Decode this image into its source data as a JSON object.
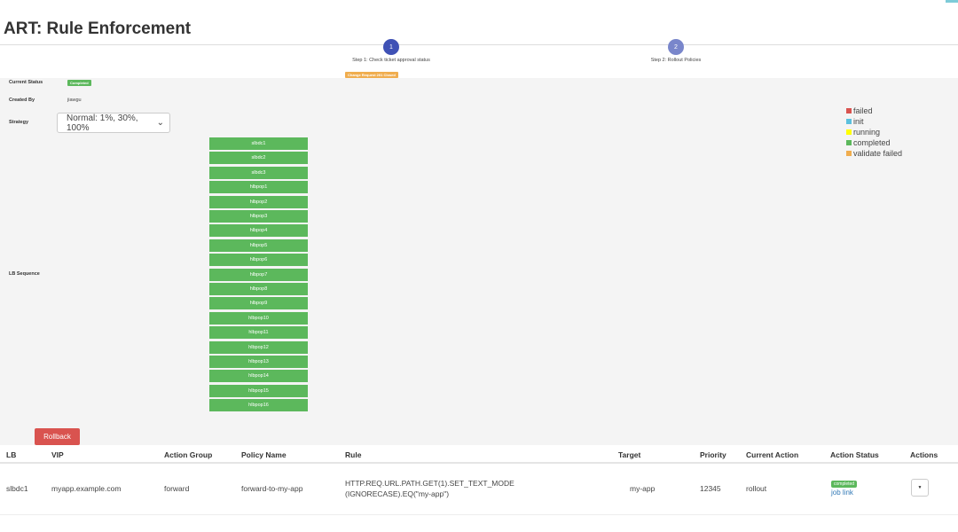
{
  "title": "ART: Rule Enforcement",
  "steps": [
    {
      "number": "1",
      "label": "Step 1: Check ticket approval status",
      "color": "#3f51b5"
    },
    {
      "number": "2",
      "label": "Step 2: Rollout Policies",
      "color": "#7986cb"
    }
  ],
  "step1_badge": "Change Request 201 Closed",
  "info": {
    "current_status_label": "Current Status",
    "current_status": "Completed",
    "created_by_label": "Created By",
    "created_by": "jiawgu",
    "strategy_label": "Strategy",
    "strategy": "Normal: 1%, 30%, 100%",
    "lb_sequence_label": "LB Sequence"
  },
  "lb_sequence": [
    "slbdc1",
    "slbdc2",
    "slbdc3",
    "hlbpop1",
    "hlbpop2",
    "hlbpop3",
    "hlbpop4",
    "hlbpop5",
    "hlbpop6",
    "hlbpop7",
    "hlbpop8",
    "hlbpop9",
    "hlbpop10",
    "hlbpop11",
    "hlbpop12",
    "hlbpop13",
    "hlbpop14",
    "hlbpop15",
    "hlbpop16"
  ],
  "legend": [
    {
      "label": "failed",
      "color": "#d9534f"
    },
    {
      "label": "init",
      "color": "#5bc0de"
    },
    {
      "label": "running",
      "color": "#ffff00"
    },
    {
      "label": "completed",
      "color": "#5cb85c"
    },
    {
      "label": "validate failed",
      "color": "#f0ad4e"
    }
  ],
  "rollback_label": "Rollback",
  "table": {
    "headers": [
      "LB",
      "VIP",
      "Action Group",
      "Policy Name",
      "Rule",
      "Target",
      "Priority",
      "Current Action",
      "Action Status",
      "Actions"
    ],
    "rows": [
      {
        "lb": "slbdc1",
        "vip": "myapp.example.com",
        "action_group": "forward",
        "policy_name": "forward-to-my-app",
        "rule_line1": "HTTP.REQ.URL.PATH.GET(1).SET_TEXT_MODE",
        "rule_line2": "(IGNORECASE).EQ(\"my-app\")",
        "target": "my-app",
        "priority": "12345",
        "current_action": "rollout",
        "action_status": "completed",
        "job_link": "job link",
        "actions_icon": "caret-down"
      }
    ]
  }
}
